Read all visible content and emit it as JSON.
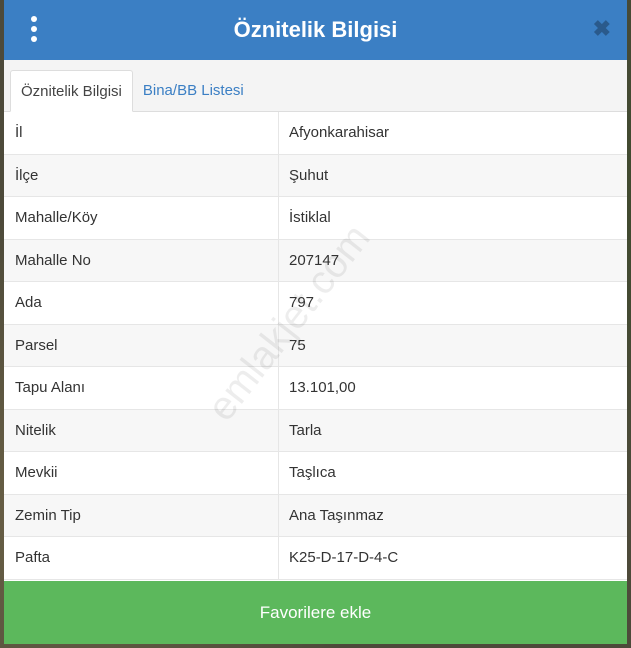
{
  "dialog": {
    "title": "Öznitelik Bilgisi",
    "close_icon": "close-icon",
    "menu_icon": "kebab-menu-icon"
  },
  "tabs": [
    {
      "label": "Öznitelik Bilgisi",
      "active": true
    },
    {
      "label": "Bina/BB Listesi",
      "active": false
    }
  ],
  "rows": [
    {
      "label": "İl",
      "value": "Afyonkarahisar"
    },
    {
      "label": "İlçe",
      "value": "Şuhut"
    },
    {
      "label": "Mahalle/Köy",
      "value": "İstiklal"
    },
    {
      "label": "Mahalle No",
      "value": "207147"
    },
    {
      "label": "Ada",
      "value": "797"
    },
    {
      "label": "Parsel",
      "value": "75"
    },
    {
      "label": "Tapu Alanı",
      "value": "13.101,00"
    },
    {
      "label": "Nitelik",
      "value": "Tarla"
    },
    {
      "label": "Mevkii",
      "value": "Taşlıca"
    },
    {
      "label": "Zemin Tip",
      "value": "Ana Taşınmaz"
    },
    {
      "label": "Pafta",
      "value": "K25-D-17-D-4-C"
    }
  ],
  "watermark": "emlakjet.com",
  "footer": {
    "favorite_label": "Favorilere ekle"
  },
  "colors": {
    "header": "#3b7fc4",
    "button": "#5cb85c"
  }
}
